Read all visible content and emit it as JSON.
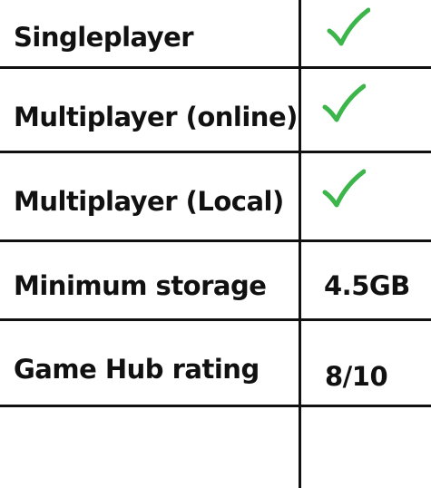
{
  "table": {
    "rows": [
      {
        "label": "Singleplayer",
        "value": "",
        "icon": "check-icon",
        "icon_color": "#3cb54a"
      },
      {
        "label": "Multiplayer (online)",
        "value": "",
        "icon": "check-icon",
        "icon_color": "#3cb54a"
      },
      {
        "label": "Multiplayer (Local)",
        "value": "",
        "icon": "check-icon",
        "icon_color": "#3cb54a"
      },
      {
        "label": "Minimum storage",
        "value": "4.5GB"
      },
      {
        "label": "Game Hub rating",
        "value": "8/10"
      },
      {
        "label": "",
        "value": ""
      }
    ],
    "line_color": "#111111"
  }
}
